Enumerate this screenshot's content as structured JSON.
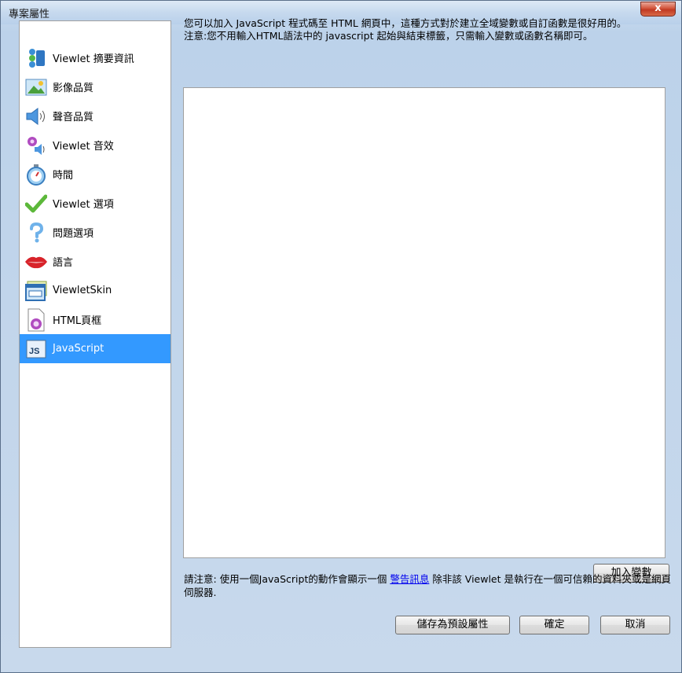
{
  "window": {
    "title": "專案屬性",
    "close_label": "x"
  },
  "sidebar": {
    "items": [
      {
        "label": "Viewlet 摘要資訊",
        "icon": "summary-icon"
      },
      {
        "label": "影像品質",
        "icon": "image-quality-icon"
      },
      {
        "label": "聲音品質",
        "icon": "speaker-icon"
      },
      {
        "label": "Viewlet 音效",
        "icon": "sound-effect-icon"
      },
      {
        "label": "時間",
        "icon": "stopwatch-icon"
      },
      {
        "label": "Viewlet 選項",
        "icon": "checkmark-icon"
      },
      {
        "label": "問題選項",
        "icon": "question-icon"
      },
      {
        "label": "語言",
        "icon": "lips-icon"
      },
      {
        "label": "ViewletSkin",
        "icon": "skin-window-icon"
      },
      {
        "label": "HTML頁框",
        "icon": "html-frame-icon"
      },
      {
        "label": "JavaScript",
        "icon": "js-icon",
        "selected": true
      }
    ]
  },
  "main": {
    "description_line1": "您可以加入 JavaScript 程式碼至 HTML 網頁中，這種方式對於建立全域變數或自訂函數是很好用的。",
    "description_line2": "注意:您不用輸入HTML語法中的 javascript 起始與結束標籤，只需輸入變數或函數名稱即可。",
    "editor_value": "",
    "add_variable_label": "加入變數",
    "note_prefix": "請注意: 使用一個JavaScript的動作會顯示一個 ",
    "note_link": "警告訊息",
    "note_suffix": " 除非該 Viewlet 是執行在一個可信賴的資料夾或是網頁伺服器."
  },
  "footer": {
    "save_default_label": "儲存為預設屬性",
    "ok_label": "確定",
    "cancel_label": "取消"
  },
  "colors": {
    "selection": "#3399ff",
    "link": "#0000ee",
    "close": "#c8432b"
  }
}
